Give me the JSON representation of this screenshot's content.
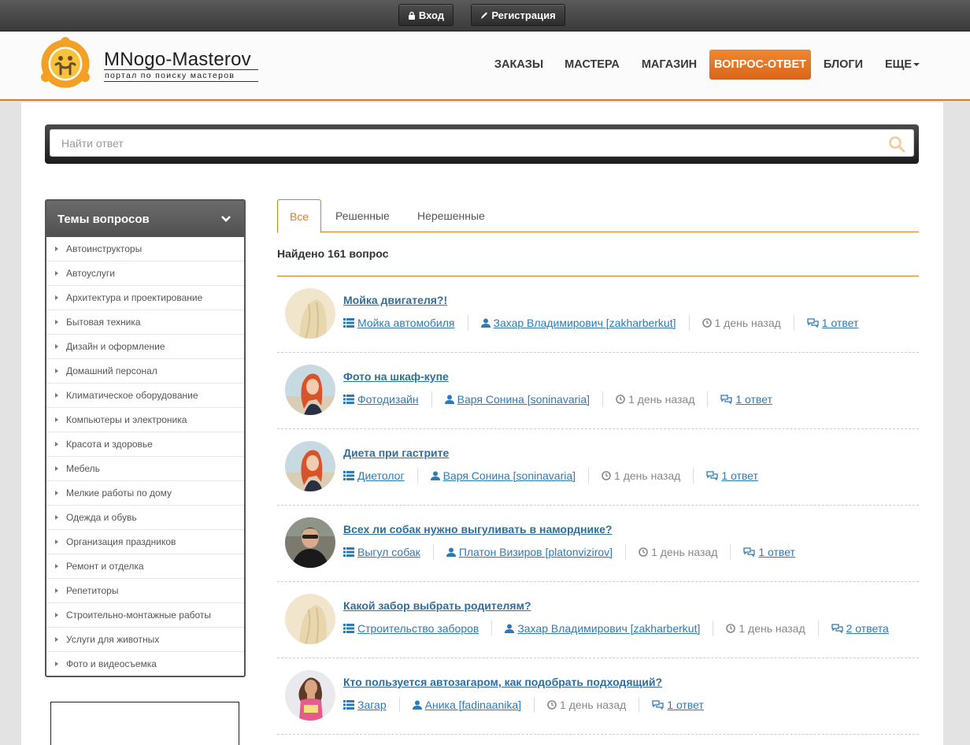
{
  "auth": {
    "login_label": "Вход",
    "register_label": "Регистрация"
  },
  "logo": {
    "title": "MNogo-Masterov",
    "subtitle": "портал по поиску мастеров"
  },
  "nav": {
    "orders": "ЗАКАЗЫ",
    "masters": "МАСТЕРА",
    "shop": "МАГАЗИН",
    "qa": "ВОПРОС-ОТВЕТ",
    "blogs": "БЛОГИ",
    "more": "ЕЩЕ"
  },
  "colors": {
    "accent": "#e07a22",
    "link": "#2f7ab5"
  },
  "search": {
    "placeholder": "Найти ответ"
  },
  "sidebar": {
    "title": "Темы вопросов",
    "items": [
      "Автоинструкторы",
      "Автоуслуги",
      "Архитектура и проектирование",
      "Бытовая техника",
      "Дизайн и оформление",
      "Домашний персонал",
      "Климатическое оборудование",
      "Компьютеры и электроника",
      "Красота и здоровье",
      "Мебель",
      "Мелкие работы по дому",
      "Одежда и обувь",
      "Организация праздников",
      "Ремонт и отделка",
      "Репетиторы",
      "Строительно-монтажные работы",
      "Услуги для животных",
      "Фото и видеосъемка"
    ]
  },
  "tabs": {
    "all": "Все",
    "solved": "Решенные",
    "unsolved": "Нерешенные"
  },
  "found": "Найдено 161 вопрос",
  "questions": [
    {
      "title": "Мойка двигателя?!",
      "category": "Мойка автомобиля",
      "author": "Захар Владимирович [zakharberkut]",
      "time": "1 день назад",
      "answers": "1 ответ"
    },
    {
      "title": "Фото на шкаф-купе",
      "category": "Фотодизайн",
      "author": "Варя Сонина [soninavaria]",
      "time": "1 день назад",
      "answers": "1 ответ"
    },
    {
      "title": "Диета при гастрите",
      "category": "Диетолог",
      "author": "Варя Сонина [soninavaria]",
      "time": "1 день назад",
      "answers": "1 ответ"
    },
    {
      "title": "Всех ли собак нужно выгуливать в наморднике?",
      "category": "Выгул собак",
      "author": "Платон Визиров [platonvizirov]",
      "time": "1 день назад",
      "answers": "1 ответ"
    },
    {
      "title": "Какой забор выбрать родителям?",
      "category": "Строительство заборов",
      "author": "Захар Владимирович [zakharberkut]",
      "time": "1 день назад",
      "answers": "2 ответа"
    },
    {
      "title": "Кто пользуется автозагаром, как подобрать подходящий?",
      "category": "Загар",
      "author": "Аника [fadinaanika]",
      "time": "1 день назад",
      "answers": "1 ответ"
    }
  ]
}
